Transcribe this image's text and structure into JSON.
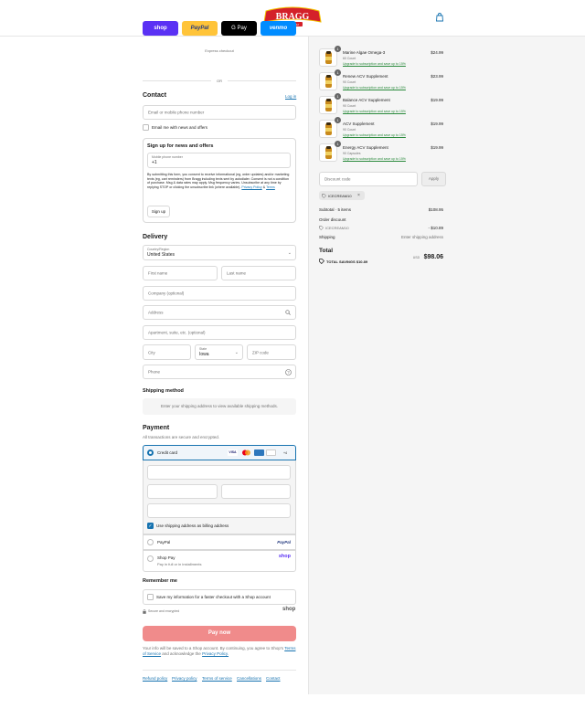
{
  "brand": {
    "logo_text": "BRAGG",
    "logo_sub": "EST. 1912"
  },
  "express": {
    "title": "Express checkout",
    "or": "OR",
    "shop": "shop",
    "paypal": "PayPal",
    "gpay": "G Pay",
    "venmo": "venmo"
  },
  "contact": {
    "title": "Contact",
    "login": "Log in",
    "placeholder": "Email or mobile phone number",
    "news_label": "Email me with news and offers"
  },
  "signup": {
    "title": "Sign up for news and offers",
    "phone_label": "Mobile phone number",
    "phone_value": "+1",
    "consent": "By submitting this form, you consent to receive informational (eg, order updates) and/or marketing texts (eg, cart reminders) from Bragg including texts sent by autodialer. Consent is not a condition of purchase. Msg & data rates may apply. Msg frequency varies. Unsubscribe at any time by replying STOP or clicking the unsubscribe link (where available).",
    "privacy": "Privacy Policy",
    "amp": "&",
    "terms": "Terms",
    "button": "Sign up"
  },
  "delivery": {
    "title": "Delivery",
    "country_label": "Country/Region",
    "country_value": "United States",
    "first_name": "First name",
    "last_name": "Last name",
    "company": "Company (optional)",
    "address": "Address",
    "apartment": "Apartment, suite, etc. (optional)",
    "city": "City",
    "state_label": "State",
    "state_value": "Iowa",
    "zip": "ZIP code",
    "phone": "Phone"
  },
  "shipping": {
    "title": "Shipping method",
    "notice": "Enter your shipping address to view available shipping methods."
  },
  "payment": {
    "title": "Payment",
    "subtitle": "All transactions are secure and encrypted.",
    "credit_card": "Credit card",
    "cards": [
      "VISA",
      "MC",
      "AMEX",
      "DISC"
    ],
    "more_cards": "+4",
    "billing_label": "Use shipping address as billing address",
    "paypal": "PayPal",
    "paypal_logo": "PayPal",
    "shop_pay": "Shop Pay",
    "shop_pay_sub": "Pay in full or in installments",
    "shop_logo": "shop"
  },
  "remember": {
    "title": "Remember me",
    "save_label": "Save my information for a faster checkout with a Shop account",
    "secure": "Secure and encrypted",
    "shop_logo": "shop"
  },
  "pay_now": "Pay now",
  "legal": {
    "text": "Your info will be saved to a Shop account. By continuing, you agree to Shop's",
    "tos": "Terms of Service",
    "mid": "and acknowledge the",
    "privacy": "Privacy Policy."
  },
  "footer": [
    "Refund policy",
    "Privacy policy",
    "Terms of service",
    "Cancellations",
    "Contact"
  ],
  "items": [
    {
      "qty": "1",
      "name": "Marine Algae Omega-3",
      "variant": "60 Count",
      "upsell": "Upgrade to subscription and save up to 15%",
      "price": "$24.99"
    },
    {
      "qty": "1",
      "name": "Renew ACV Supplement",
      "variant": "90 Count",
      "upsell": "Upgrade to subscription and save up to 15%",
      "price": "$23.99"
    },
    {
      "qty": "1",
      "name": "Balance ACV Supplement",
      "variant": "90 Count",
      "upsell": "Upgrade to subscription and save up to 15%",
      "price": "$19.99"
    },
    {
      "qty": "1",
      "name": "ACV Supplement",
      "variant": "90 Count",
      "upsell": "Upgrade to subscription and save up to 15%",
      "price": "$19.99"
    },
    {
      "qty": "1",
      "name": "Energy ACV Supplement",
      "variant": "90 Capsules",
      "upsell": "Upgrade to subscription and save up to 15%",
      "price": "$19.99"
    }
  ],
  "discount": {
    "placeholder": "Discount code",
    "apply": "Apply",
    "tag": "ICECREAM10"
  },
  "summary": {
    "subtotal_label": "Subtotal · 5 items",
    "subtotal": "$108.95",
    "order_discount": "Order discount",
    "code": "ICECREAM10",
    "discount_amount": "- $10.89",
    "shipping_label": "Shipping",
    "shipping_value": "Enter shipping address",
    "total_label": "Total",
    "currency": "USD",
    "total": "$98.06",
    "savings_label": "TOTAL SAVINGS",
    "savings": "$10.89"
  },
  "colors": {
    "accent": "#1773b0",
    "pay_button": "#f08b8b",
    "brand_red": "#d4202a",
    "shop_purple": "#5a31f4",
    "paypal_yellow": "#ffc439",
    "venmo_blue": "#008cff"
  }
}
